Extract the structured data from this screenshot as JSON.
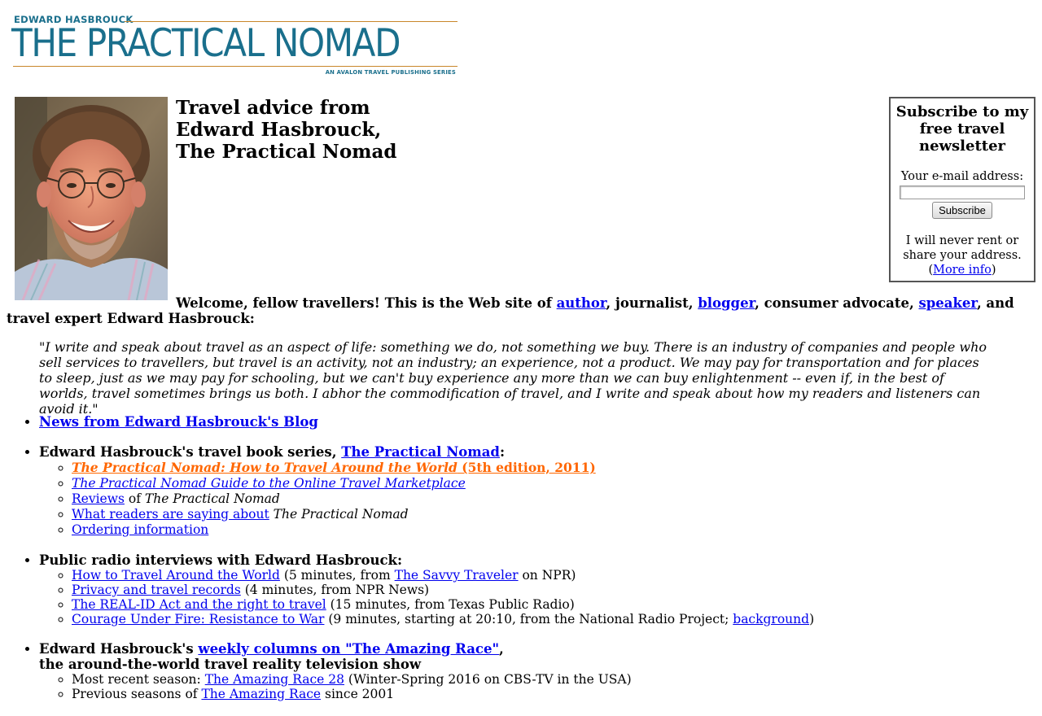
{
  "logo": {
    "author": "EDWARD HASBROUCK",
    "title": "THE PRACTICAL NOMAD",
    "series": "AN AVALON TRAVEL PUBLISHING SERIES"
  },
  "intro": {
    "heading_line1": "Travel advice from",
    "heading_line2": "Edward Hasbrouck,",
    "heading_line3": "The Practical Nomad"
  },
  "newsletter": {
    "title": "Subscribe to my free travel newsletter",
    "email_label": "Your e-mail address:",
    "email_value": "",
    "subscribe_label": "Subscribe",
    "privacy_text": "I will never rent or share your address.",
    "more_info_label": "More info"
  },
  "welcome": {
    "lead": "Welcome, fellow travellers! This is the Web site of ",
    "author_link": "author",
    "after_author": ", journalist, ",
    "blogger_link": "blogger",
    "after_blogger": ", consumer advocate, ",
    "speaker_link": "speaker",
    "tail": ", and travel expert Edward Hasbrouck:"
  },
  "quote": "\"I write and speak about travel as an aspect of life: something we do, not something we buy. There is an industry of companies and people who sell services to travellers, but travel is an activity, not an industry; an experience, not a product. We may pay for transportation and for places to sleep, just as we may pay for schooling, but we can't buy experience any more than we can buy enlightenment -- even if, in the best of worlds, travel sometimes brings us both. I abhor the commodification of travel, and I write and speak about how my readers and listeners can avoid it.\"",
  "blog_news": {
    "label": "News from Edward Hasbrouck's Blog"
  },
  "book_series": {
    "lead": "Edward Hasbrouck's travel book series, ",
    "link": "The Practical Nomad",
    "colon": ":",
    "featured_title": "The Practical Nomad: How to Travel Around the World",
    "featured_edition": " (5th edition, 2011)",
    "guide_title": "The Practical Nomad Guide to the Online Travel Marketplace",
    "reviews_link": "Reviews",
    "of_text": " of ",
    "book_name": "The Practical Nomad",
    "readers_link": "What readers are saying about",
    "ordering_link": "Ordering information"
  },
  "radio": {
    "heading": "Public radio interviews with Edward Hasbrouck:",
    "items": [
      {
        "title": "How to Travel Around the World",
        "pre": " (5 minutes, from ",
        "source_link": "The Savvy Traveler",
        "post": " on NPR)"
      },
      {
        "title": "Privacy and travel records",
        "note": " (4 minutes, from NPR News)"
      },
      {
        "title": "The REAL-ID Act and the right to travel",
        "note": " (15 minutes, from Texas Public Radio)"
      },
      {
        "title": "Courage Under Fire: Resistance to War",
        "note": " (9 minutes, starting at 20:10, from the National Radio Project; ",
        "background_link": "background",
        "close": ")"
      }
    ]
  },
  "amazing_race": {
    "lead": "Edward Hasbrouck's ",
    "link": "weekly columns on \"The Amazing Race\"",
    "comma": ",",
    "line2": "the around-the-world travel reality television show",
    "recent_prefix": "Most recent season: ",
    "recent_link": "The Amazing Race 28",
    "recent_note": " (Winter-Spring 2016 on CBS-TV in the USA)",
    "previous_prefix": "Previous seasons of ",
    "previous_link": "The Amazing Race",
    "previous_suffix": " since 2001"
  }
}
